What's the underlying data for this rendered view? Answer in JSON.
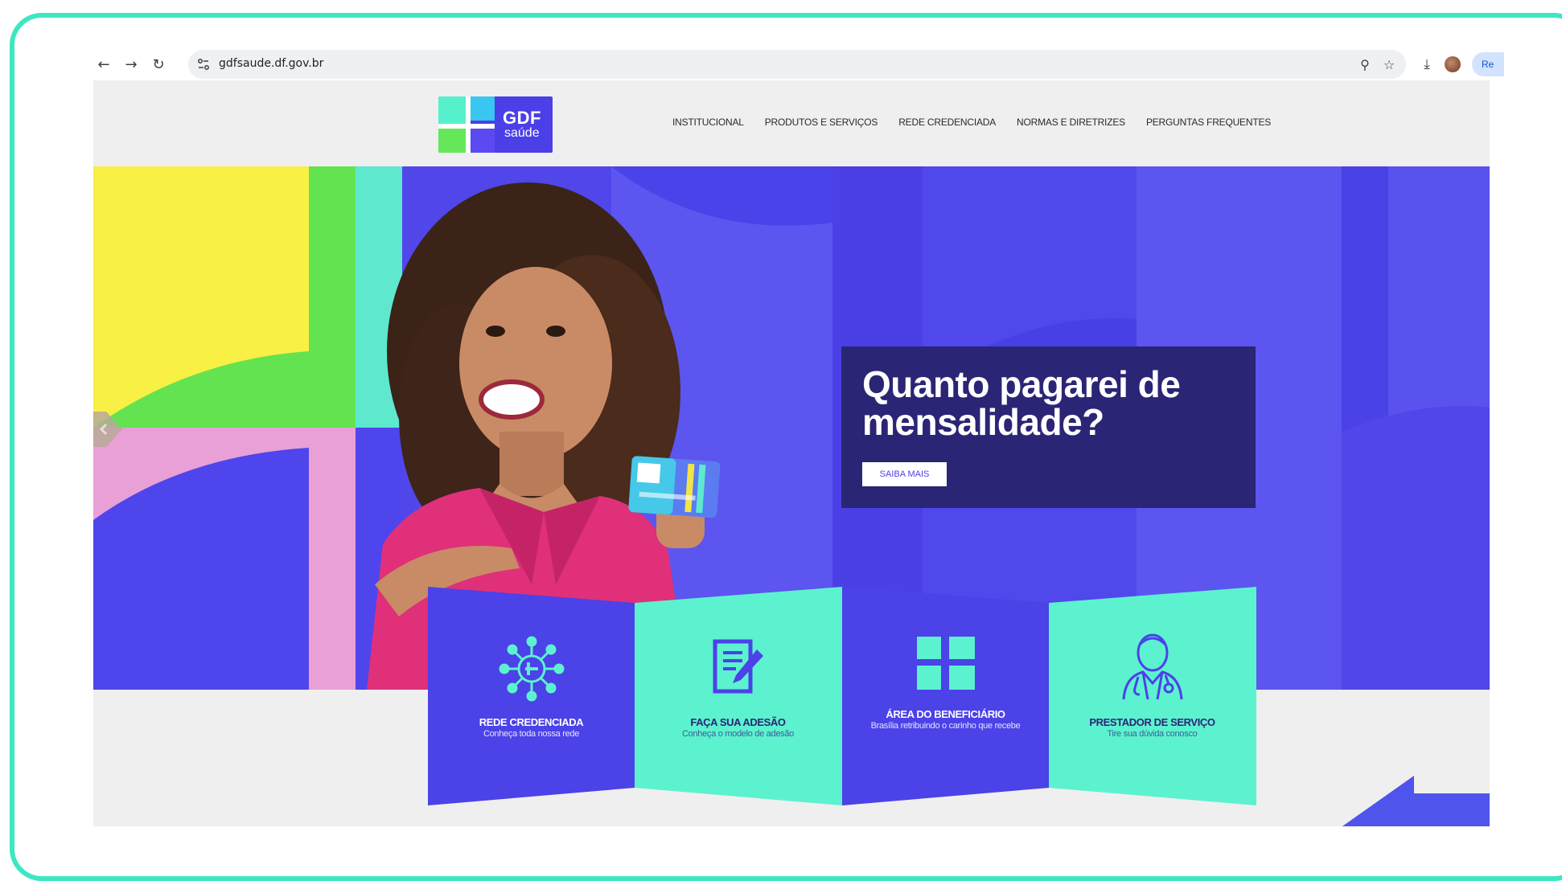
{
  "browser": {
    "url": "gdfsaude.df.gov.br",
    "back_glyph": "←",
    "forward_glyph": "→",
    "reload_glyph": "↻",
    "zoom_glyph": "⚲",
    "star_glyph": "☆",
    "download_glyph": "⤓",
    "profile_text": "Re"
  },
  "header": {
    "logo_main": "GDF",
    "logo_sub": "saúde",
    "nav": [
      "INSTITUCIONAL",
      "PRODUTOS E SERVIÇOS",
      "REDE CREDENCIADA",
      "NORMAS E DIRETRIZES",
      "PERGUNTAS FREQUENTES"
    ]
  },
  "hero": {
    "headline": "Quanto pagarei de mensalidade?",
    "button": "SAIBA MAIS"
  },
  "cards": [
    {
      "title": "REDE CREDENCIADA",
      "subtitle": "Conheça toda nossa rede",
      "icon": "network-icon"
    },
    {
      "title": "FAÇA SUA ADESÃO",
      "subtitle": "Conheça o modelo de adesão",
      "icon": "form-edit-icon"
    },
    {
      "title": "ÁREA DO BENEFICIÁRIO",
      "subtitle": "Brasília retribuindo o carinho que recebe",
      "icon": "gdf-cross-icon"
    },
    {
      "title": "PRESTADOR DE SERVIÇO",
      "subtitle": "Tire sua dúvida conosco",
      "icon": "doctor-icon"
    }
  ],
  "colors": {
    "frame": "#3ee6c4",
    "brand_blue": "#4b3fe7",
    "brand_teal": "#5cf2cf",
    "promo_bg": "#2a2575",
    "annotation_arrow": "#4f55ec"
  }
}
